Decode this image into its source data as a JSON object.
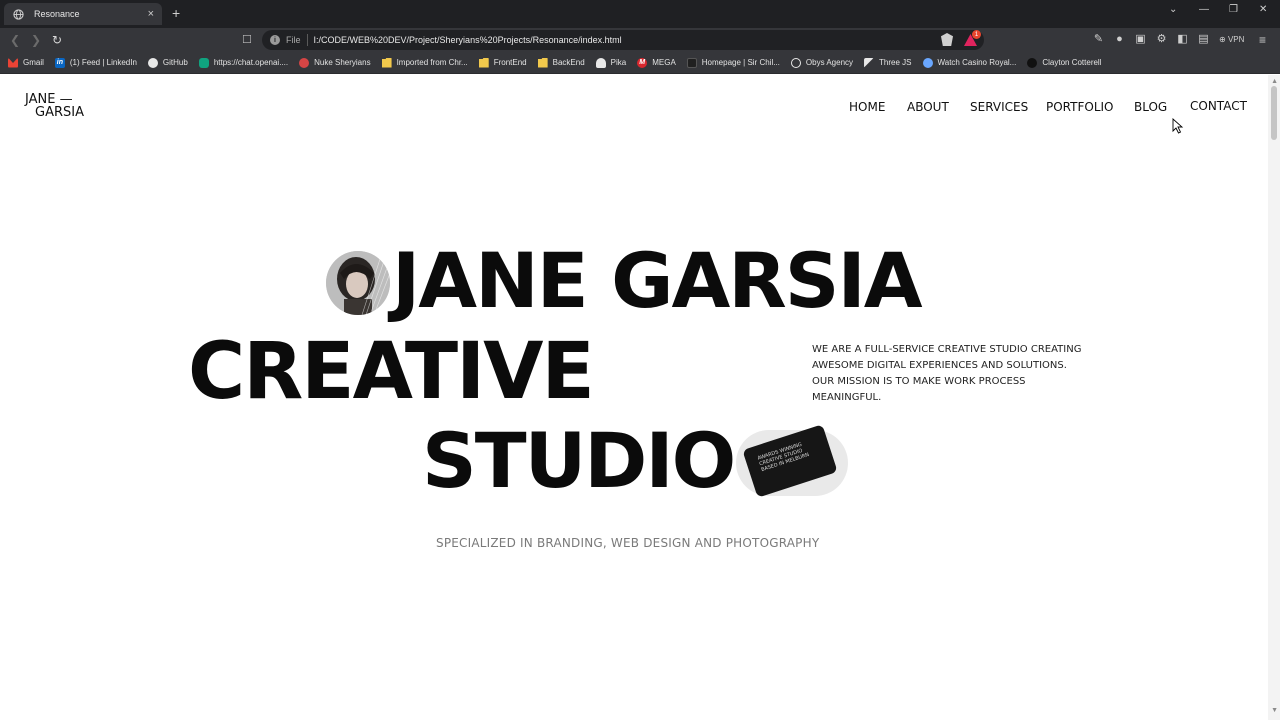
{
  "browser": {
    "tab_title": "Resonance",
    "tab_close": "×",
    "new_tab": "+",
    "url_scheme": "File",
    "url": "I:/CODE/WEB%20DEV/Project/Sheryians%20Projects/Resonance/index.html",
    "rewards_count": "1",
    "vpn_label": "VPN",
    "window_controls": [
      "⌄",
      "—",
      "❐",
      "✕"
    ],
    "bookmarks": [
      {
        "label": "Gmail",
        "icon": "gmail-icon"
      },
      {
        "label": "(1) Feed | LinkedIn",
        "icon": "linkedin-icon"
      },
      {
        "label": "GitHub",
        "icon": "github-icon"
      },
      {
        "label": "https://chat.openai....",
        "icon": "chatgpt-icon"
      },
      {
        "label": "Nuke Sheryians",
        "icon": "nuke-icon"
      },
      {
        "label": "Imported from Chr...",
        "icon": "folder-icon"
      },
      {
        "label": "FrontEnd",
        "icon": "folder-icon"
      },
      {
        "label": "BackEnd",
        "icon": "folder-icon"
      },
      {
        "label": "Pika",
        "icon": "pika-icon"
      },
      {
        "label": "MEGA",
        "icon": "mega-icon"
      },
      {
        "label": "Homepage | Sir Chil...",
        "icon": "site-icon"
      },
      {
        "label": "Obys Agency",
        "icon": "obys-icon"
      },
      {
        "label": "Three JS",
        "icon": "threejs-icon"
      },
      {
        "label": "Watch Casino Royal...",
        "icon": "casino-icon"
      },
      {
        "label": "Clayton Cotterell",
        "icon": "clayton-icon"
      }
    ]
  },
  "site": {
    "logo_line1": "JANE —",
    "logo_line2": "GARSIA",
    "nav": [
      "HOME",
      "ABOUT",
      "SERVICES",
      "PORTFOLIO",
      "BLOG",
      "CONTACT"
    ],
    "hero": {
      "line1": "JANE GARSIA",
      "line2": "CREATIVE",
      "line3": "STUDIO"
    },
    "card_text": [
      "AWARDS WINNING",
      "CREATIVE STUDIO",
      "BASED IN MELBURN"
    ],
    "description": "WE ARE A FULL-SERVICE CREATIVE STUDIO CREATING AWESOME DIGITAL EXPERIENCES AND SOLUTIONS. OUR MISSION IS TO MAKE WORK PROCESS MEANINGFUL.",
    "specialized": "SPECIALIZED IN BRANDING, WEB DESIGN AND PHOTOGRAPHY"
  }
}
